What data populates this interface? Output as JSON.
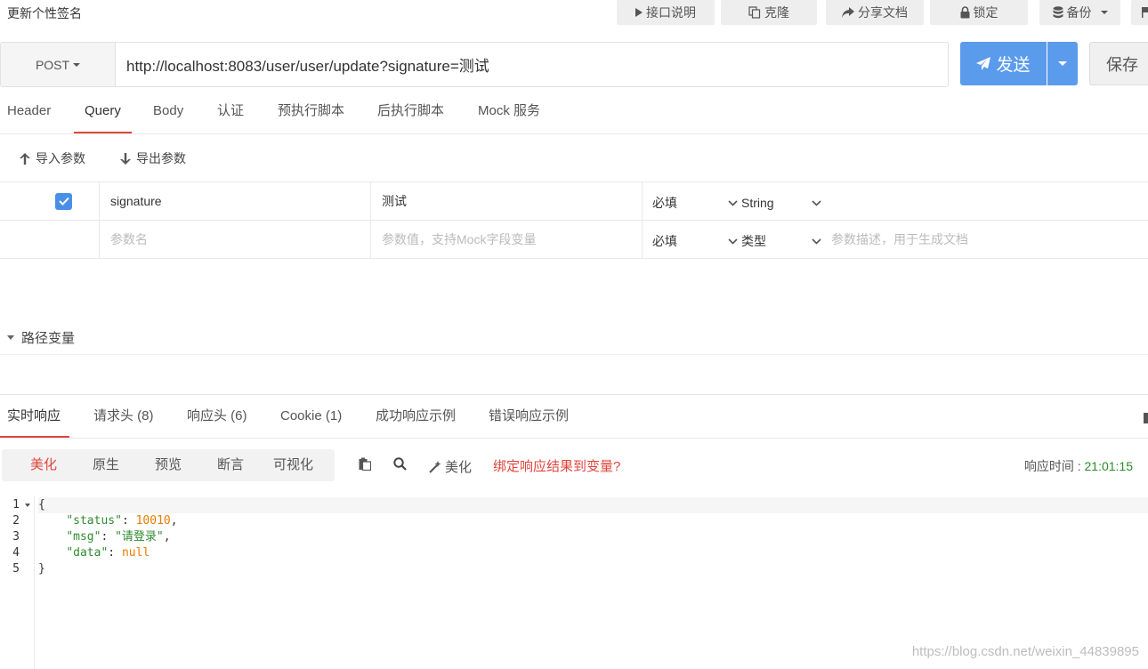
{
  "topbar": {
    "title": "更新个性签名",
    "buttons": [
      {
        "label": "接口说明",
        "icon": "play-icon"
      },
      {
        "label": "克隆",
        "icon": "copy-icon"
      },
      {
        "label": "分享文档",
        "icon": "share-icon"
      },
      {
        "label": "锁定",
        "icon": "lock-icon"
      },
      {
        "label": "备份",
        "icon": "database-icon"
      }
    ]
  },
  "request": {
    "method": "POST",
    "url": "http://localhost:8083/user/user/update?signature=测试",
    "send_label": "发送",
    "save_label": "保存"
  },
  "request_tabs": [
    "Header",
    "Query",
    "Body",
    "认证",
    "预执行脚本",
    "后执行脚本",
    "Mock 服务"
  ],
  "active_request_tab": "Query",
  "param_tools": {
    "import_label": "导入参数",
    "export_label": "导出参数"
  },
  "params": {
    "rows": [
      {
        "checked": true,
        "name": "signature",
        "value": "测试",
        "required": "必填",
        "type": "String",
        "description": ""
      }
    ],
    "new_row": {
      "name_placeholder": "参数名",
      "value_placeholder": "参数值，支持Mock字段变量",
      "required": "必填",
      "type_placeholder": "类型",
      "description_placeholder": "参数描述，用于生成文档"
    }
  },
  "path_variables": {
    "label": "路径变量"
  },
  "response_tabs": [
    "实时响应",
    "请求头 (8)",
    "响应头 (6)",
    "Cookie (1)",
    "成功响应示例",
    "错误响应示例"
  ],
  "active_response_tab": "实时响应",
  "response_modes": [
    "美化",
    "原生",
    "预览",
    "断言",
    "可视化"
  ],
  "active_response_mode": "美化",
  "response_tools": {
    "beautify_label": "美化",
    "bind_label": "绑定响应结果到变量?",
    "time_label": "响应时间 : ",
    "time_value": "21:01:15"
  },
  "response_body": {
    "line_numbers": [
      "1",
      "2",
      "3",
      "4",
      "5"
    ],
    "open_brace": "{",
    "close_brace": "}",
    "fields": [
      {
        "key": "\"status\"",
        "value": "10010",
        "kind": "number",
        "comma": ","
      },
      {
        "key": "\"msg\"",
        "value": "\"请登录\"",
        "kind": "string",
        "comma": ","
      },
      {
        "key": "\"data\"",
        "value": "null",
        "kind": "null",
        "comma": ""
      }
    ]
  },
  "watermark": "https://blog.csdn.net/weixin_44839895",
  "colors": {
    "accent": "#e0453d",
    "primary": "#5b9bec",
    "json_key": "#2e8b2e",
    "json_number": "#e87c00"
  }
}
